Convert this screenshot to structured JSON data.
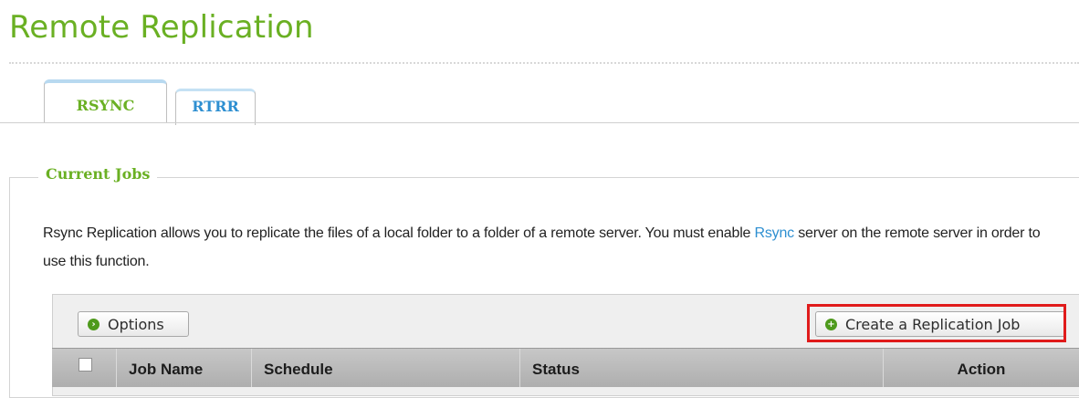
{
  "page": {
    "title": "Remote Replication"
  },
  "tabs": [
    {
      "label": "RSYNC",
      "active": true
    },
    {
      "label": "RTRR",
      "active": false
    }
  ],
  "section": {
    "legend": "Current Jobs",
    "description_before": "Rsync Replication allows you to replicate the files of a local folder to a folder of a remote server. You must enable ",
    "description_link": "Rsync",
    "description_after": " server on the remote server in order to use this function."
  },
  "toolbar": {
    "options_label": "Options",
    "create_label": "Create a Replication Job"
  },
  "table": {
    "columns": [
      "Job Name",
      "Schedule",
      "Status",
      "Action"
    ]
  },
  "colors": {
    "accent_green": "#6ab023",
    "link_blue": "#2e8fd1",
    "highlight_red": "#e01b1b"
  }
}
